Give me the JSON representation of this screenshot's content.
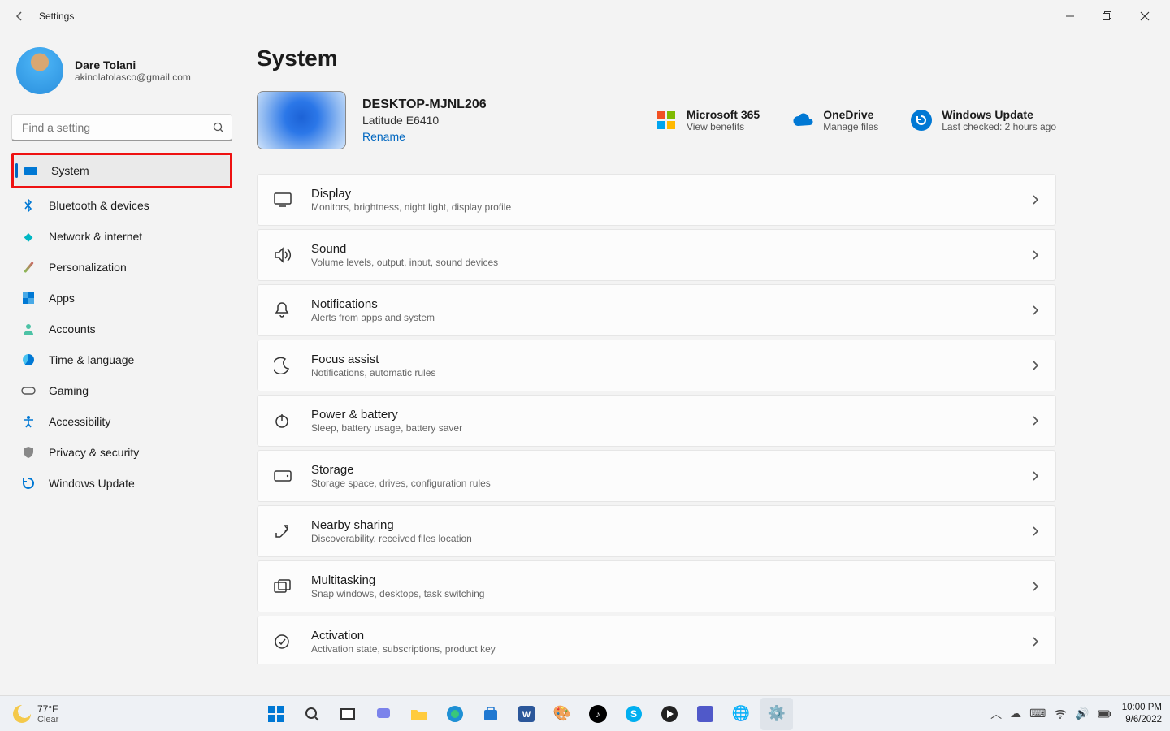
{
  "window": {
    "title": "Settings"
  },
  "profile": {
    "name": "Dare Tolani",
    "email": "akinolatolasco@gmail.com"
  },
  "search": {
    "placeholder": "Find a setting"
  },
  "nav": [
    {
      "id": "system",
      "label": "System",
      "active": true
    },
    {
      "id": "bluetooth",
      "label": "Bluetooth & devices"
    },
    {
      "id": "network",
      "label": "Network & internet"
    },
    {
      "id": "personalization",
      "label": "Personalization"
    },
    {
      "id": "apps",
      "label": "Apps"
    },
    {
      "id": "accounts",
      "label": "Accounts"
    },
    {
      "id": "time",
      "label": "Time & language"
    },
    {
      "id": "gaming",
      "label": "Gaming"
    },
    {
      "id": "accessibility",
      "label": "Accessibility"
    },
    {
      "id": "privacy",
      "label": "Privacy & security"
    },
    {
      "id": "update",
      "label": "Windows Update"
    }
  ],
  "page": {
    "title": "System"
  },
  "device": {
    "name": "DESKTOP-MJNL206",
    "model": "Latitude E6410",
    "rename": "Rename"
  },
  "headerTiles": {
    "m365": {
      "title": "Microsoft 365",
      "sub": "View benefits"
    },
    "onedrive": {
      "title": "OneDrive",
      "sub": "Manage files"
    },
    "update": {
      "title": "Windows Update",
      "sub": "Last checked: 2 hours ago"
    }
  },
  "settings": [
    {
      "id": "display",
      "title": "Display",
      "sub": "Monitors, brightness, night light, display profile"
    },
    {
      "id": "sound",
      "title": "Sound",
      "sub": "Volume levels, output, input, sound devices"
    },
    {
      "id": "notifications",
      "title": "Notifications",
      "sub": "Alerts from apps and system"
    },
    {
      "id": "focus",
      "title": "Focus assist",
      "sub": "Notifications, automatic rules"
    },
    {
      "id": "power",
      "title": "Power & battery",
      "sub": "Sleep, battery usage, battery saver"
    },
    {
      "id": "storage",
      "title": "Storage",
      "sub": "Storage space, drives, configuration rules"
    },
    {
      "id": "nearby",
      "title": "Nearby sharing",
      "sub": "Discoverability, received files location"
    },
    {
      "id": "multitasking",
      "title": "Multitasking",
      "sub": "Snap windows, desktops, task switching"
    },
    {
      "id": "activation",
      "title": "Activation",
      "sub": "Activation state, subscriptions, product key"
    }
  ],
  "taskbar": {
    "weather": {
      "temp": "77°F",
      "cond": "Clear"
    },
    "clock": {
      "time": "10:00 PM",
      "date": "9/6/2022"
    },
    "apps": [
      "start",
      "search",
      "taskview",
      "chat",
      "explorer",
      "edge",
      "store",
      "word",
      "paint",
      "tiktok",
      "skype",
      "media",
      "teams",
      "browser",
      "settings"
    ]
  }
}
